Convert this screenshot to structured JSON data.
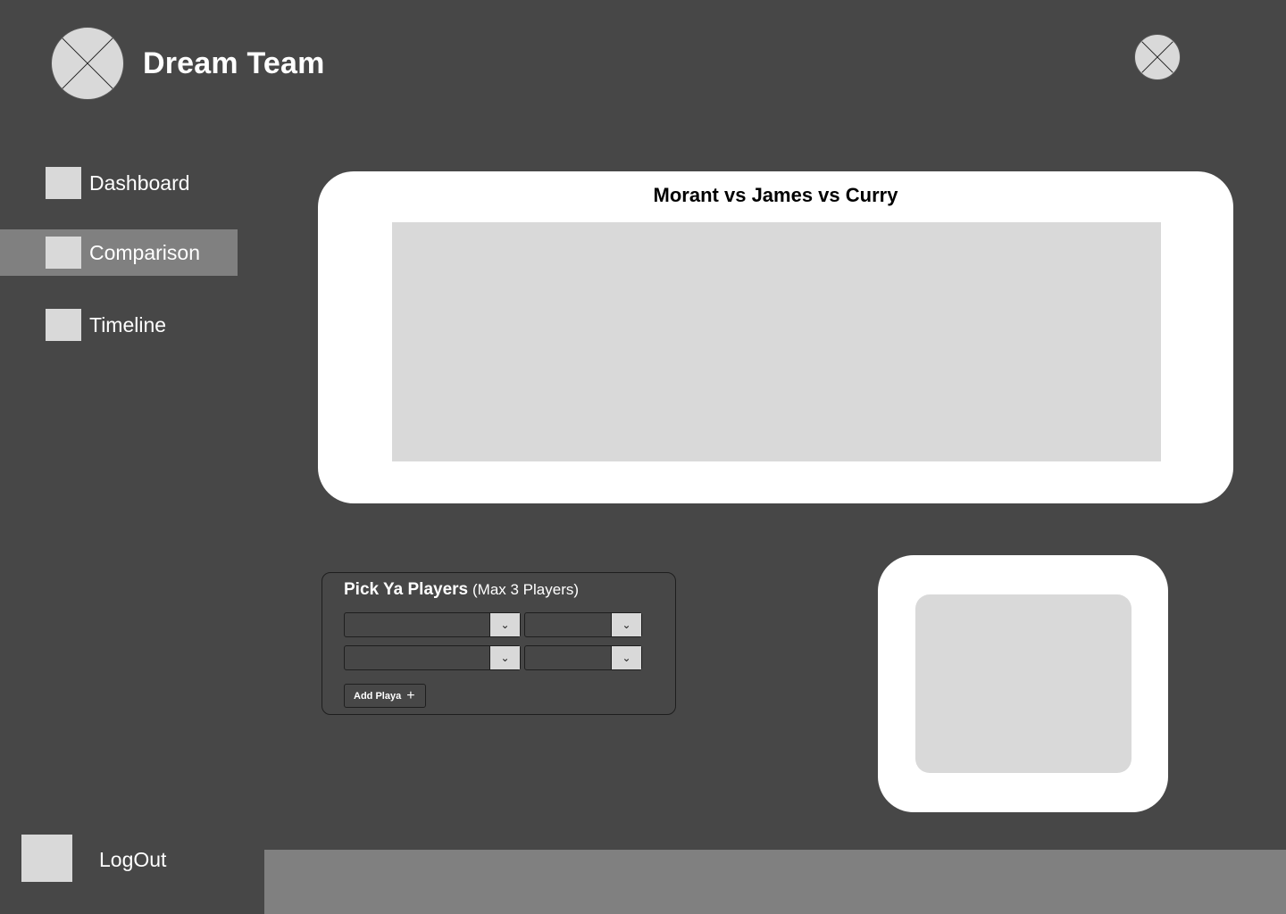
{
  "header": {
    "logo_icon": "image-placeholder-icon",
    "title": "Dream Team",
    "avatar_icon": "image-placeholder-icon"
  },
  "sidebar": {
    "items": [
      {
        "label": "Dashboard",
        "icon": "square-placeholder-icon",
        "active": false
      },
      {
        "label": "Comparison",
        "icon": "square-placeholder-icon",
        "active": true
      },
      {
        "label": "Timeline",
        "icon": "square-placeholder-icon",
        "active": false
      }
    ],
    "logout_label": "LogOut"
  },
  "main": {
    "chart_title": "Morant vs James vs Curry"
  },
  "picker": {
    "title": "Pick Ya Players",
    "subtitle": "(Max 3 Players)",
    "selects": [
      {
        "value": ""
      },
      {
        "value": ""
      },
      {
        "value": ""
      },
      {
        "value": ""
      }
    ],
    "add_button_label": "Add Playa",
    "add_button_icon": "plus-icon"
  },
  "colors": {
    "background": "#474747",
    "active_nav": "#808080",
    "placeholder": "#d9d9d9",
    "card": "#ffffff"
  }
}
